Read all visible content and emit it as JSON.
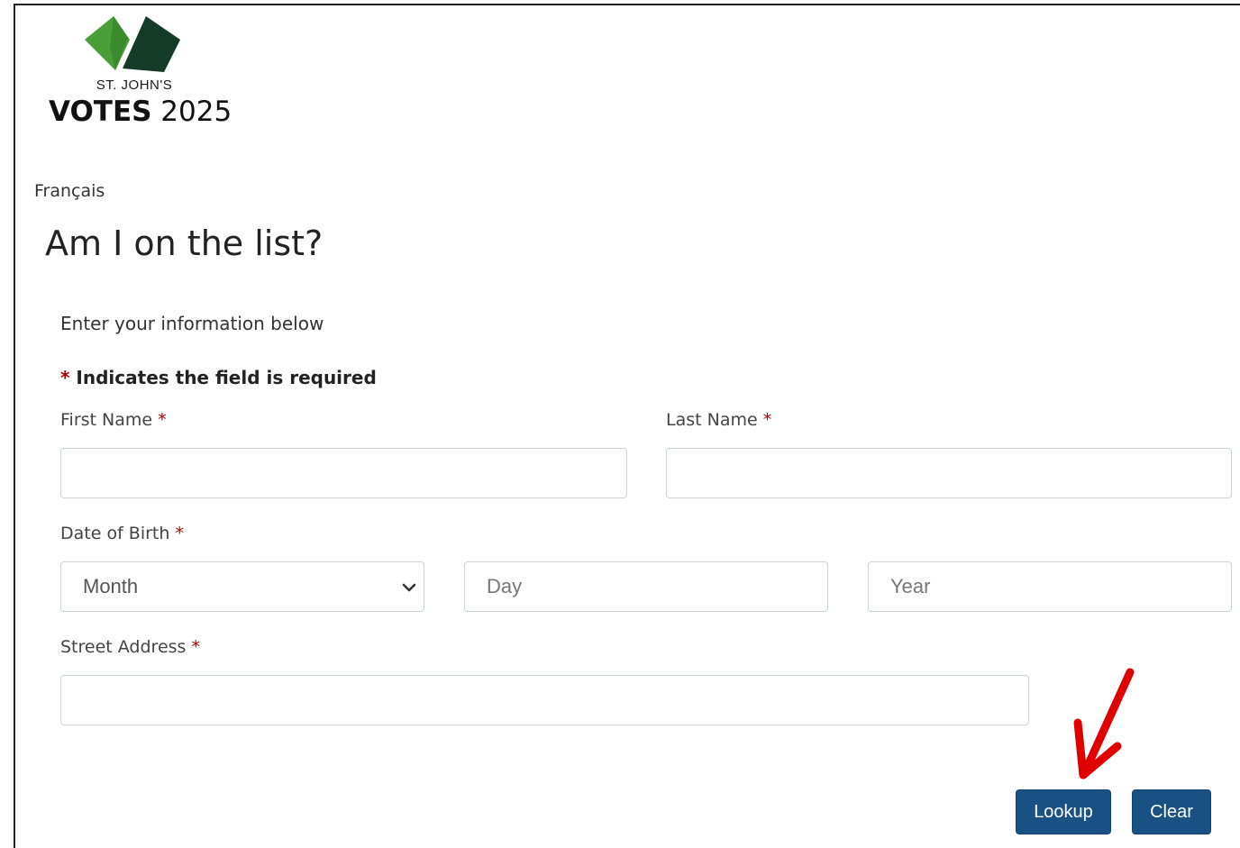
{
  "logo": {
    "line1": "ST. JOHN'S",
    "line2_bold": "VOTES",
    "line2_year": " 2025",
    "colors": {
      "green": "#4a9e3a",
      "dark": "#123524"
    }
  },
  "language_link": "Français",
  "page_title": "Am I on the list?",
  "form": {
    "intro": "Enter your information below",
    "required_note_star": "*",
    "required_note_text": " Indicates the field is required",
    "first_name_label": "First Name",
    "last_name_label": "Last Name",
    "dob_label": "Date of Birth",
    "street_label": "Street Address",
    "required_star": "*",
    "month_selected": "Month",
    "day_placeholder": "Day",
    "year_placeholder": "Year",
    "first_name_value": "",
    "last_name_value": "",
    "street_value": ""
  },
  "buttons": {
    "lookup": "Lookup",
    "clear": "Clear",
    "color": "#1a5185"
  },
  "annotation": {
    "arrow_icon": "red-arrow-icon",
    "color": "#e00000"
  }
}
